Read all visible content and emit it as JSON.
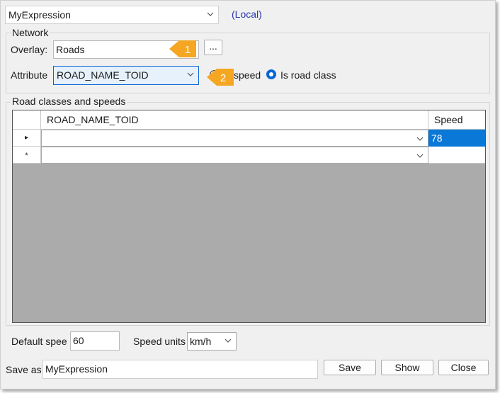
{
  "top": {
    "expression_value": "MyExpression",
    "scope_label": "(Local)"
  },
  "network": {
    "title": "Network",
    "overlay_label": "Overlay:",
    "overlay_value": "Roads",
    "browse_label": "...",
    "attribute_label": "Attribute",
    "attribute_value": "ROAD_NAME_TOID",
    "radio_speed_label": "speed",
    "radio_roadclass_label": "Is road class",
    "selected_radio": "Is road class"
  },
  "callouts": {
    "one": "1",
    "two": "2",
    "color": "#f5a623"
  },
  "road_classes": {
    "title": "Road classes and speeds",
    "columns": [
      "ROAD_NAME_TOID",
      "Speed"
    ],
    "rows": [
      {
        "indicator": "▸",
        "class_value": "",
        "speed": "78"
      },
      {
        "indicator": "*",
        "class_value": "",
        "speed": ""
      }
    ]
  },
  "bottom": {
    "default_speed_label": "Default spee",
    "default_speed_value": "60",
    "speed_units_label": "Speed units",
    "speed_units_value": "km/h",
    "save_as_label": "Save as",
    "save_as_value": "MyExpression",
    "save_button": "Save",
    "show_button": "Show",
    "close_button": "Close"
  },
  "colors": {
    "accent": "#0a64d6",
    "selection": "#0a78d7",
    "link": "#2a36b1"
  }
}
